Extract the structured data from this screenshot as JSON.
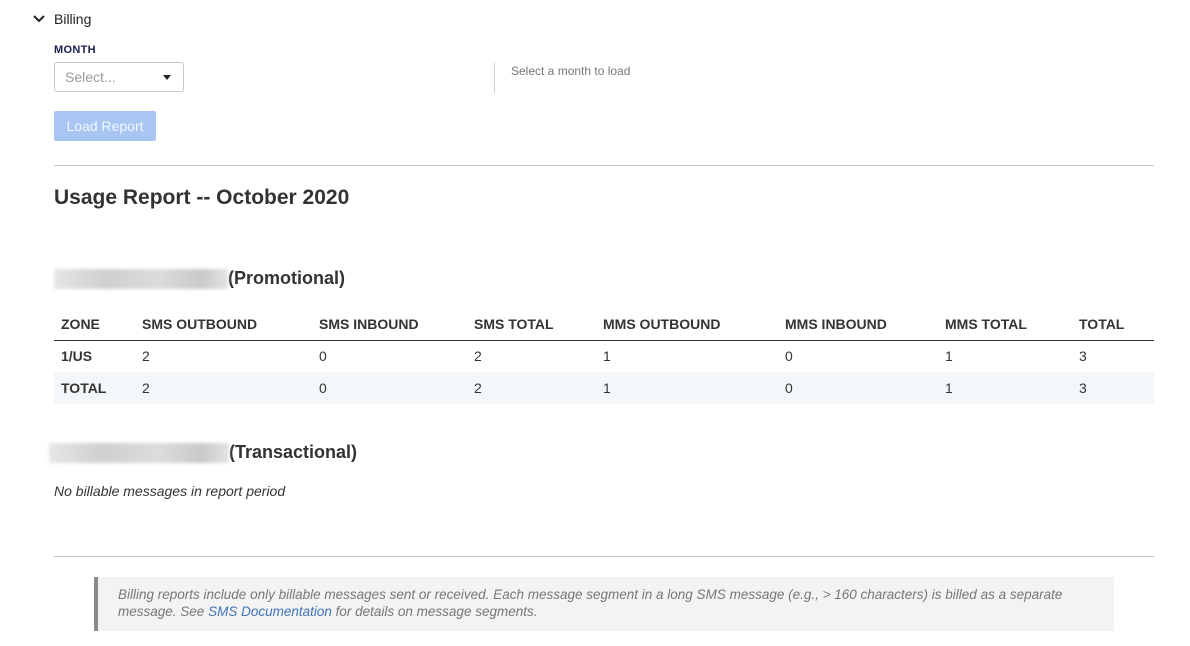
{
  "section": {
    "title": "Billing"
  },
  "filter": {
    "month_label": "MONTH",
    "select_placeholder": "Select...",
    "hint": "Select a month to load",
    "load_button": "Load Report"
  },
  "report": {
    "title": "Usage Report -- October 2020",
    "promotional": {
      "suffix": "(Promotional)",
      "columns": [
        "ZONE",
        "SMS OUTBOUND",
        "SMS INBOUND",
        "SMS TOTAL",
        "MMS OUTBOUND",
        "MMS INBOUND",
        "MMS TOTAL",
        "TOTAL"
      ],
      "rows": [
        [
          "1/US",
          "2",
          "0",
          "2",
          "1",
          "0",
          "1",
          "3"
        ],
        [
          "TOTAL",
          "2",
          "0",
          "2",
          "1",
          "0",
          "1",
          "3"
        ]
      ]
    },
    "transactional": {
      "suffix": "(Transactional)",
      "empty_message": "No billable messages in report period"
    }
  },
  "note": {
    "text_before": "Billing reports include only billable messages sent or received. Each message segment in a long SMS message (e.g., > 160 characters) is billed as a separate message. See ",
    "link_text": "SMS Documentation",
    "text_after": " for details on message segments."
  },
  "colors": {
    "button_disabled": "#a9c5f2",
    "link": "#3f74b5",
    "label_navy": "#1a1f4e"
  }
}
